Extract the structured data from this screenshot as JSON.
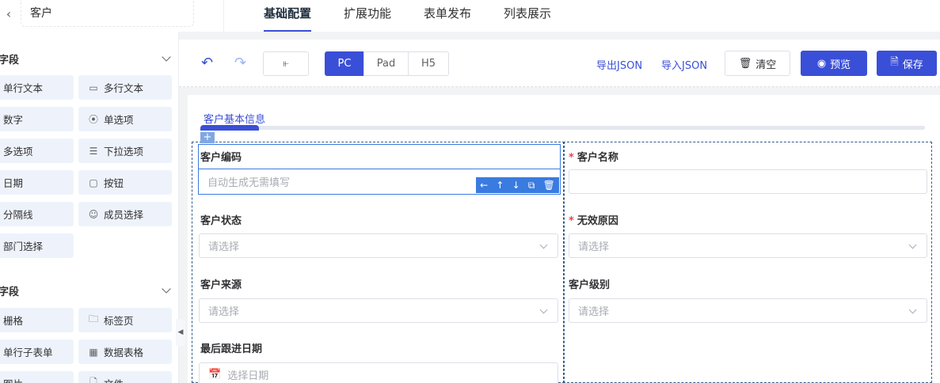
{
  "header": {
    "back_icon": "chevron-left-icon",
    "title": "客户",
    "tabs": [
      "基础配置",
      "扩展功能",
      "表单发布",
      "列表展示"
    ],
    "active_tab": "基础配置"
  },
  "sidebar": {
    "groups": [
      {
        "title": "字段",
        "items": [
          {
            "label": "单行文本",
            "icon": "text-icon"
          },
          {
            "label": "多行文本",
            "icon": "textarea-icon"
          },
          {
            "label": "数字",
            "icon": "number-icon"
          },
          {
            "label": "单选项",
            "icon": "radio-icon"
          },
          {
            "label": "多选项",
            "icon": "checkbox-icon"
          },
          {
            "label": "下拉选项",
            "icon": "select-icon"
          },
          {
            "label": "日期",
            "icon": "date-icon"
          },
          {
            "label": "按钮",
            "icon": "button-icon"
          },
          {
            "label": "分隔线",
            "icon": "divider-icon"
          },
          {
            "label": "成员选择",
            "icon": "user-icon"
          },
          {
            "label": "部门选择",
            "icon": "department-icon"
          }
        ]
      },
      {
        "title": "字段",
        "items": [
          {
            "label": "栅格",
            "icon": "grid-icon"
          },
          {
            "label": "标签页",
            "icon": "tabs-icon"
          },
          {
            "label": "单行子表单",
            "icon": "subform-icon"
          },
          {
            "label": "数据表格",
            "icon": "table-icon"
          },
          {
            "label": "图片",
            "icon": "image-icon"
          },
          {
            "label": "文件",
            "icon": "file-icon"
          }
        ]
      }
    ]
  },
  "toolbar": {
    "undo_icon": "undo-icon",
    "redo_icon": "redo-icon",
    "tree_icon": "tree-icon",
    "devices": [
      "PC",
      "Pad",
      "H5"
    ],
    "active_device": "PC",
    "export_json": "导出JSON",
    "import_json": "导入JSON",
    "clear": "清空",
    "preview": "预览",
    "save": "保存"
  },
  "form": {
    "tab_label": "客户基本信息",
    "fields": {
      "code": {
        "label": "客户编码",
        "placeholder": "自动生成无需填写",
        "required": false
      },
      "name": {
        "label": "客户名称",
        "placeholder": "",
        "required": true
      },
      "status": {
        "label": "客户状态",
        "placeholder": "请选择",
        "required": false
      },
      "invalid_reason": {
        "label": "无效原因",
        "placeholder": "请选择",
        "required": true
      },
      "source": {
        "label": "客户来源",
        "placeholder": "请选择",
        "required": false
      },
      "level": {
        "label": "客户级别",
        "placeholder": "请选择",
        "required": false
      },
      "last_follow_date": {
        "label": "最后跟进日期",
        "placeholder": "选择日期",
        "required": false
      }
    },
    "selected_field_actions": [
      "arrow-left-icon",
      "arrow-up-icon",
      "arrow-down-icon",
      "copy-icon",
      "delete-icon"
    ]
  }
}
